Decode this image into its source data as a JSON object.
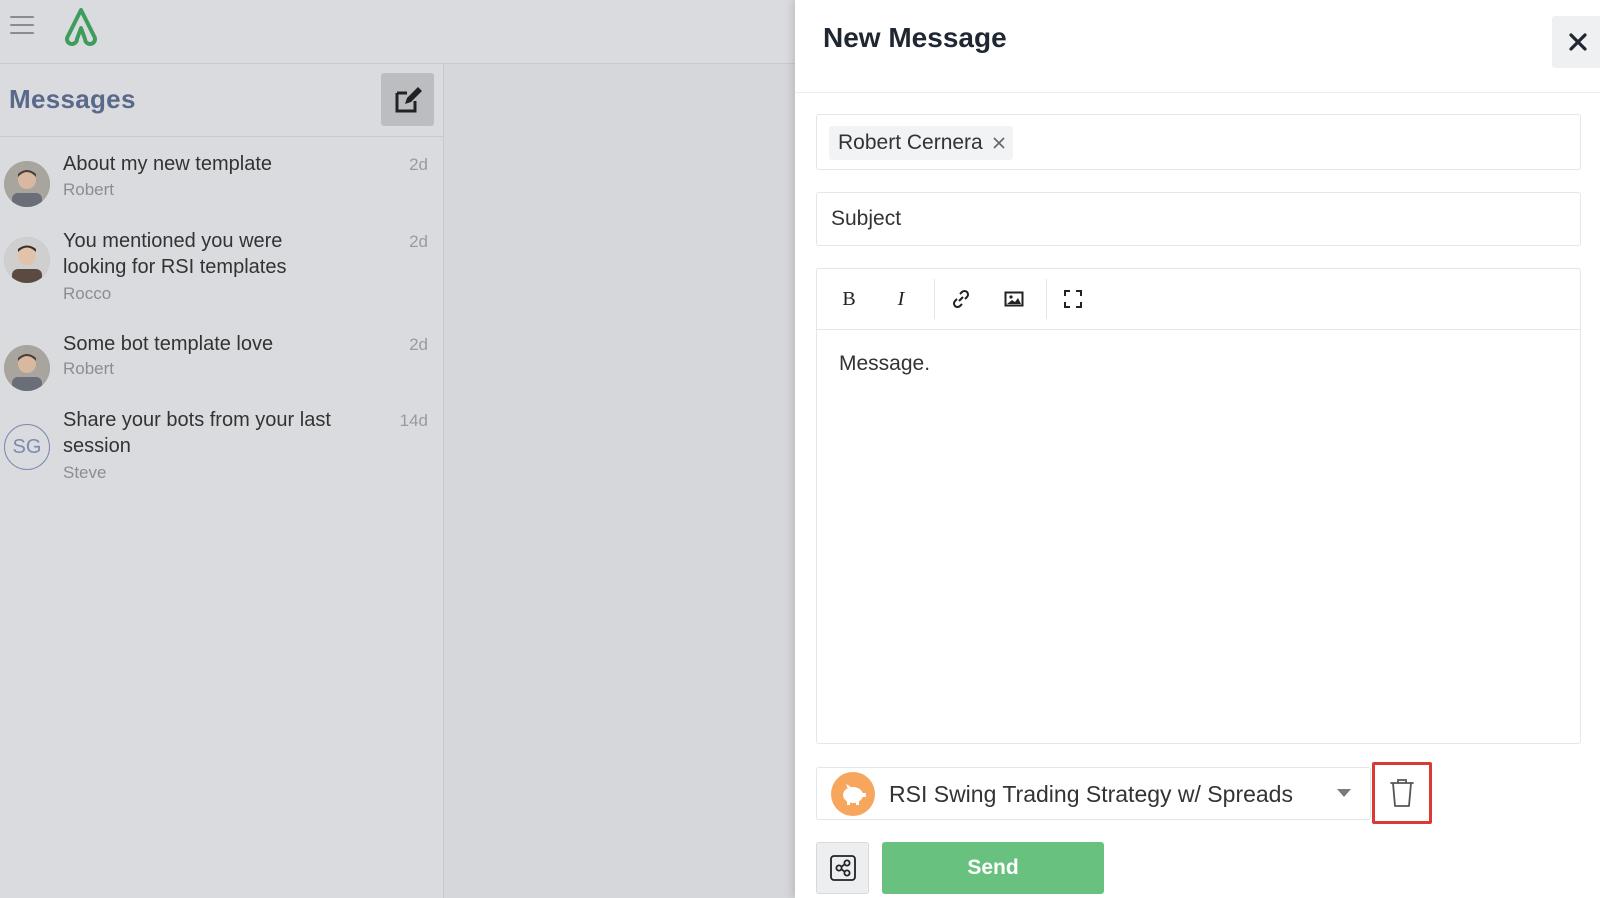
{
  "app": {
    "logo_icon": "triangle-loop-logo",
    "brand_color": "#3e9d5c"
  },
  "sidebar": {
    "title": "Messages",
    "compose_icon": "edit-icon",
    "conversations": [
      {
        "subject": "About my new template",
        "sender": "Robert",
        "time": "2d",
        "avatar": "photo"
      },
      {
        "subject": "You mentioned you were looking for RSI templates",
        "sender": "Rocco",
        "time": "2d",
        "avatar": "photo"
      },
      {
        "subject": "Some bot template love",
        "sender": "Robert",
        "time": "2d",
        "avatar": "photo"
      },
      {
        "subject": "Share your bots from your last session",
        "sender": "Steve",
        "time": "14d",
        "avatar": "SG"
      }
    ]
  },
  "panel": {
    "title": "New Message",
    "close_icon": "close-icon",
    "recipients": [
      {
        "name": "Robert Cernera"
      }
    ],
    "subject_placeholder": "Subject",
    "toolbar": [
      {
        "name": "bold",
        "label": "B"
      },
      {
        "name": "italic",
        "label": "I"
      },
      {
        "name": "link",
        "icon": "link-icon"
      },
      {
        "name": "image",
        "icon": "image-icon"
      },
      {
        "name": "fullscreen",
        "icon": "fullscreen-icon"
      }
    ],
    "message_text": "Message.",
    "template": {
      "label": "RSI Swing Trading Strategy w/ Spreads",
      "icon": "piggy-bank-icon"
    },
    "delete_icon": "trash-icon",
    "share_icon": "share-icon",
    "send_label": "Send",
    "colors": {
      "send": "#69c17f",
      "highlight": "#d93a35",
      "template_icon_bg": "#f7a75d"
    }
  }
}
